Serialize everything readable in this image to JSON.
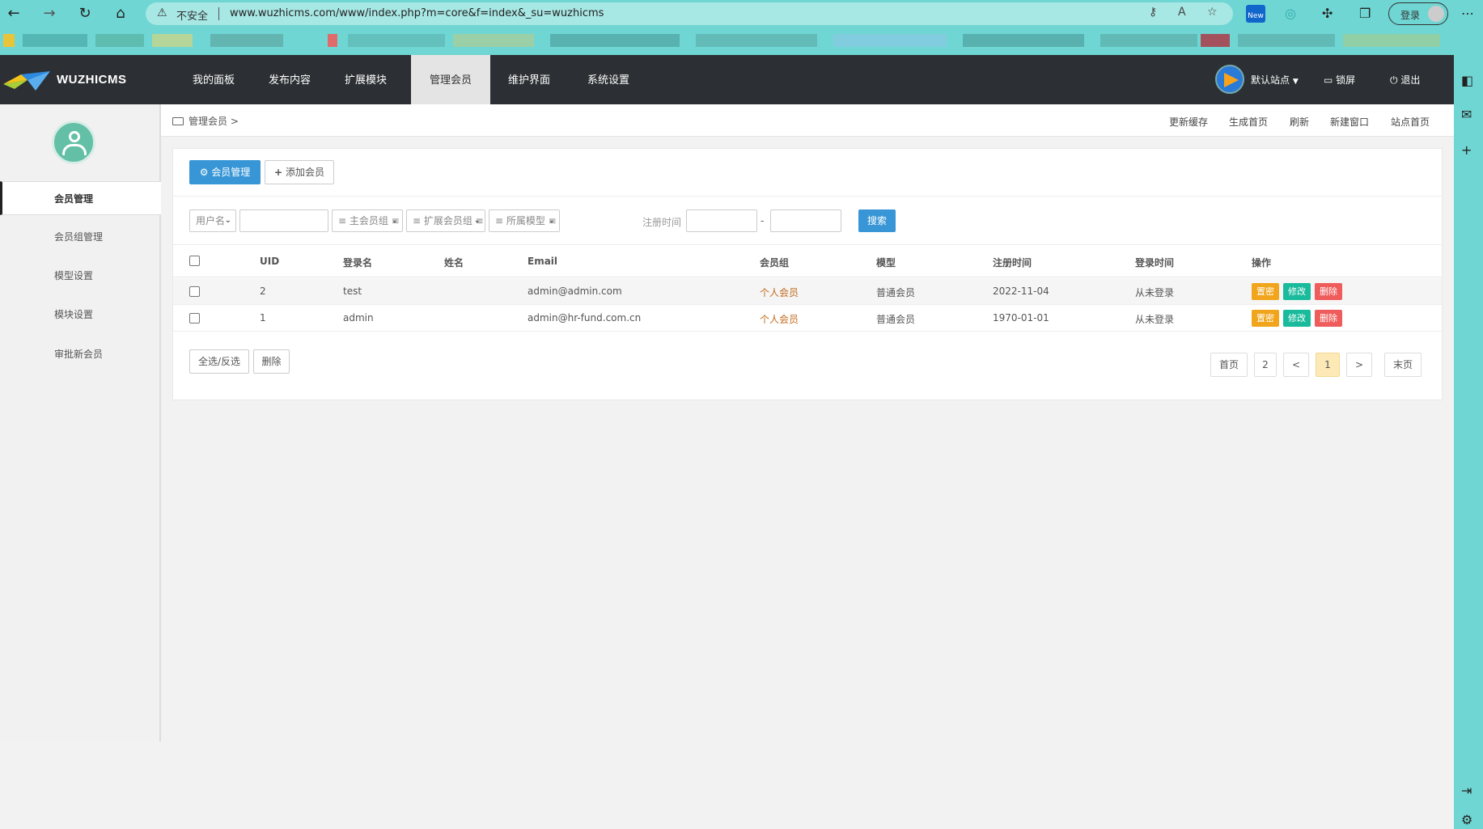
{
  "browser": {
    "security_label": "不安全",
    "url": "www.wuzhicms.com/www/index.php?m=core&f=index&_su=wuzhicms",
    "new_badge": "New",
    "login_label": "登录"
  },
  "header": {
    "brand": "WUZHICMS",
    "menu": [
      "我的面板",
      "发布内容",
      "扩展模块",
      "管理会员",
      "维护界面",
      "系统设置"
    ],
    "active_menu": "管理会员",
    "site_label": "默认站点",
    "lock_label": "锁屏",
    "logout_label": "退出"
  },
  "sidebar": {
    "items": [
      "会员管理",
      "会员组管理",
      "模型设置",
      "模块设置",
      "审批新会员"
    ],
    "active": "会员管理"
  },
  "breadcrumb": {
    "text": "管理会员 >",
    "links": [
      "更新缓存",
      "生成首页",
      "刷新",
      "新建窗口",
      "站点首页"
    ]
  },
  "tabs": {
    "manage": "会员管理",
    "add": "添加会员"
  },
  "filters": {
    "field_select": "用户名",
    "main_group": "≡ 主会员组 ≡",
    "ext_group": "≡ 扩展会员组 ≡",
    "model": "≡ 所属模型 ≡",
    "reg_time_label": "注册时间",
    "range_sep": "-",
    "search": "搜索"
  },
  "table": {
    "headers": [
      "UID",
      "登录名",
      "姓名",
      "Email",
      "会员组",
      "模型",
      "注册时间",
      "登录时间",
      "操作"
    ],
    "rows": [
      {
        "uid": "2",
        "username": "test",
        "name": "",
        "email": "admin@admin.com",
        "group": "个人会员",
        "model": "普通会员",
        "reg_time": "2022-11-04",
        "login_time": "从未登录"
      },
      {
        "uid": "1",
        "username": "admin",
        "name": "",
        "email": "admin@hr-fund.com.cn",
        "group": "个人会员",
        "model": "普通会员",
        "reg_time": "1970-01-01",
        "login_time": "从未登录"
      }
    ],
    "actions": {
      "reset": "置密",
      "edit": "修改",
      "delete": "删除"
    }
  },
  "bulk": {
    "select_all": "全选/反选",
    "delete": "删除"
  },
  "pagination": {
    "first": "首页",
    "total_pages": "2",
    "prev": "<",
    "current": "1",
    "next": ">",
    "last": "末页"
  },
  "colors": {
    "primary": "#3896d6",
    "header_bg": "#2c2f33",
    "browser_accent": "#6fd6d3",
    "avatar": "#63c0a6",
    "group_text": "#c26b1c",
    "action_reset": "#f0a51c",
    "action_edit": "#1abb9c",
    "action_delete": "#ef5c5c",
    "page_current": "#fce9b6"
  }
}
